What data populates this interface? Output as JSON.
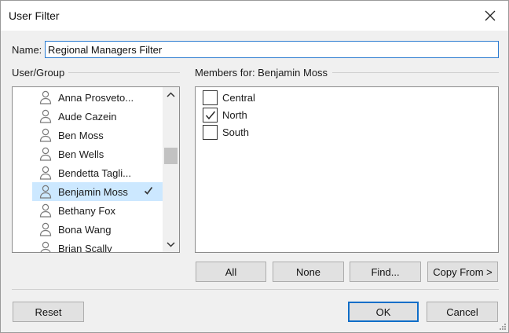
{
  "window": {
    "title": "User Filter"
  },
  "name_field": {
    "label": "Name:",
    "value": "Regional Managers Filter"
  },
  "user_group": {
    "label": "User/Group",
    "users": [
      {
        "name": "Anna Prosveto...",
        "selected": false
      },
      {
        "name": "Aude Cazein",
        "selected": false
      },
      {
        "name": "Ben Moss",
        "selected": false
      },
      {
        "name": "Ben Wells",
        "selected": false
      },
      {
        "name": "Bendetta Tagli...",
        "selected": false
      },
      {
        "name": "Benjamin Moss",
        "selected": true
      },
      {
        "name": "Bethany Fox",
        "selected": false
      },
      {
        "name": "Bona Wang",
        "selected": false
      },
      {
        "name": "Brian Scally",
        "selected": false
      }
    ]
  },
  "members": {
    "label": "Members for: Benjamin Moss",
    "items": [
      {
        "name": "Central",
        "checked": false
      },
      {
        "name": "North",
        "checked": true
      },
      {
        "name": "South",
        "checked": false
      }
    ]
  },
  "buttons": {
    "all": "All",
    "none": "None",
    "find": "Find...",
    "copy_from": "Copy From >",
    "reset": "Reset",
    "ok": "OK",
    "cancel": "Cancel"
  },
  "icons": {
    "close": "close-icon",
    "user": "user-icon",
    "check": "checkmark-icon",
    "scroll_up": "chevron-up-icon",
    "scroll_down": "chevron-down-icon",
    "resize": "resize-grip-icon"
  },
  "colors": {
    "selection_bg": "#cce8ff",
    "focus_border": "#2b7bd0",
    "primary_button_border": "#0f6ec8",
    "dialog_bg": "#f0f0f0"
  }
}
